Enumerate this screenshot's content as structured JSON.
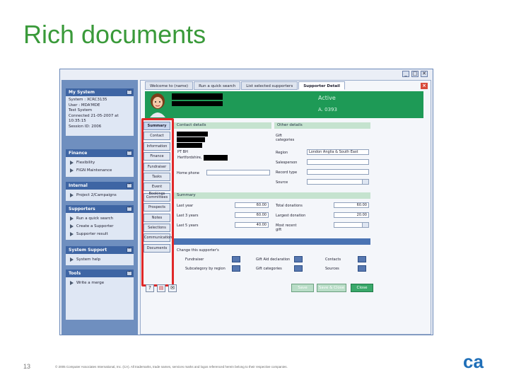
{
  "slide": {
    "title": "Rich documents",
    "page_number": "13",
    "copyright": "© 2005 Computer Associates International, Inc. (CA). All trademarks, trade names, services marks and logos referenced herein belong to their respective companies.",
    "logo_text": "ca"
  },
  "window": {
    "controls": [
      "_",
      "□",
      "✕"
    ]
  },
  "nav": {
    "system": {
      "header": "My System",
      "lines": [
        "System : XCRC3135",
        "User : MDA'MDE",
        "Test System",
        "Connected 21-05-2007 at",
        "10:35:15",
        "Session ID: 2006"
      ]
    },
    "finance": {
      "header": "Finance",
      "items": [
        "Flexibility",
        "FIGN Maintenance"
      ]
    },
    "internal": {
      "header": "Internal",
      "items": [
        "Project 2/Campaigns"
      ]
    },
    "supporters": {
      "header": "Supporters",
      "items": [
        "Run a quick search",
        "Create a Supporter",
        "Supporter result"
      ]
    },
    "system_support": {
      "header": "System Support",
      "items": [
        "System help"
      ]
    },
    "tools": {
      "header": "Tools",
      "items": [
        "Write a merge"
      ]
    }
  },
  "tabs": [
    "Welcome to (name)",
    "Run a quick search",
    "List selected supporters",
    "Supporter Detail"
  ],
  "active_tab": 3,
  "header": {
    "status": "Active",
    "account": "A. 0393"
  },
  "side_buttons": [
    "Summary",
    "Contact",
    "Information",
    "Finance",
    "Fundraiser",
    "Tasks",
    "Event Bookings",
    "Committees",
    "Prospects",
    "Notes",
    "Selections",
    "Communications",
    "Documents"
  ],
  "contact": {
    "header": "Contact details",
    "address_lines": [
      "PT BH",
      "Hertfordshire,"
    ],
    "phone_label": "Home phone"
  },
  "other": {
    "header": "Other details",
    "labels": [
      "Gift categories",
      "Region",
      "Salesperson",
      "Record type",
      "Source"
    ],
    "region_value": "London Anglia & South East"
  },
  "summary": {
    "header": "Summary",
    "left": [
      {
        "label": "Last year",
        "value": "60.00"
      },
      {
        "label": "Last 3 years",
        "value": "60.00"
      },
      {
        "label": "Last 5 years",
        "value": "40.00"
      }
    ],
    "right": [
      {
        "label": "Total donations",
        "value": "60.00"
      },
      {
        "label": "Largest donation",
        "value": "20.00"
      },
      {
        "label": "Most recent gift",
        "value": ""
      }
    ]
  },
  "prompts": {
    "header": "",
    "intro": "Change this supporter's",
    "items": [
      "Fundraiser",
      "Subcategory by region",
      "Gift Aid declaration",
      "Gift categories",
      "Contacts",
      "Sources"
    ]
  },
  "buttons": {
    "save": "Save",
    "save_close": "Save & Close",
    "close": "Close"
  },
  "icons": {
    "help": "help-icon",
    "print": "print-icon",
    "email": "email-icon"
  },
  "colors": {
    "title_green": "#3a9a3a",
    "banner_green": "#1e9a56",
    "nav_blue": "#6f8fbf",
    "highlight_red": "#e02828"
  }
}
